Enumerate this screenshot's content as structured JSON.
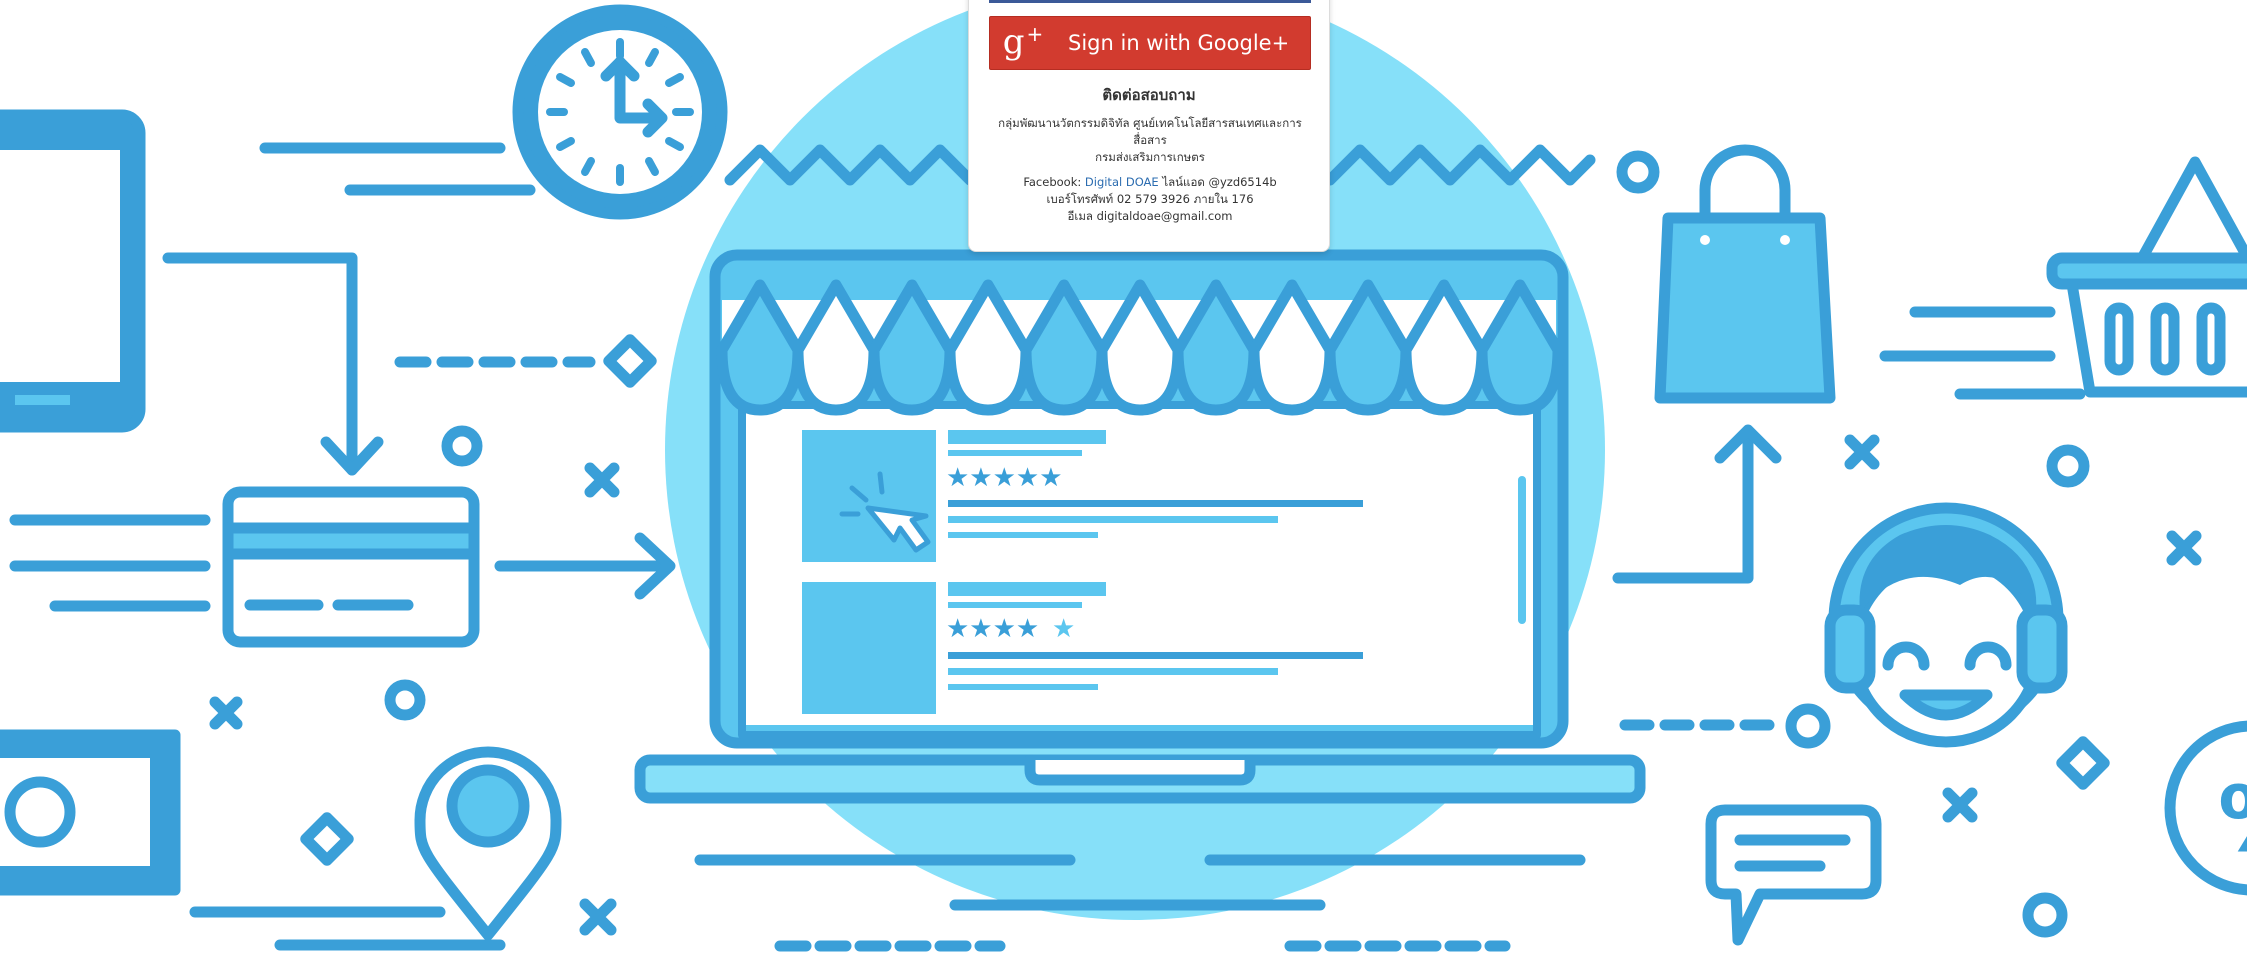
{
  "colors": {
    "primary": "#3a9fd8",
    "light": "#5bc6ef",
    "pale": "#86e0f9",
    "dark": "#2b89c6",
    "google_red": "#d23b2f",
    "facebook_blue": "#3b5998"
  },
  "illustration": {
    "storefront": {
      "rating_1": 5,
      "rating_2": 4.5
    },
    "icons": [
      "tablet-icon",
      "clock-icon",
      "credit-card-icon",
      "banknote-icon",
      "map-pin-icon",
      "storefront-laptop-icon",
      "shopping-bag-icon",
      "shopping-basket-icon",
      "support-agent-icon",
      "chat-bubble-icon",
      "percent-badge-icon"
    ]
  },
  "login": {
    "google_button": {
      "icon": "g+",
      "label": "Sign in with Google+"
    }
  },
  "contact": {
    "title": "ติดต่อสอบถาม",
    "org_line1": "กลุ่มพัฒนานวัตกรรมดิจิทัล ศูนย์เทคโนโลยีสารสนเทศและการ",
    "org_line2": "สื่อสาร",
    "org_line3": "กรมส่งเสริมการเกษตร",
    "facebook_prefix": "Facebook: ",
    "facebook_link": "Digital DOAE",
    "line_text": " ไลน์แอด @yzd6514b",
    "phone": "เบอร์โทรศัพท์ 02 579 3926 ภายใน 176",
    "email": "อีเมล digitaldoae@gmail.com"
  }
}
